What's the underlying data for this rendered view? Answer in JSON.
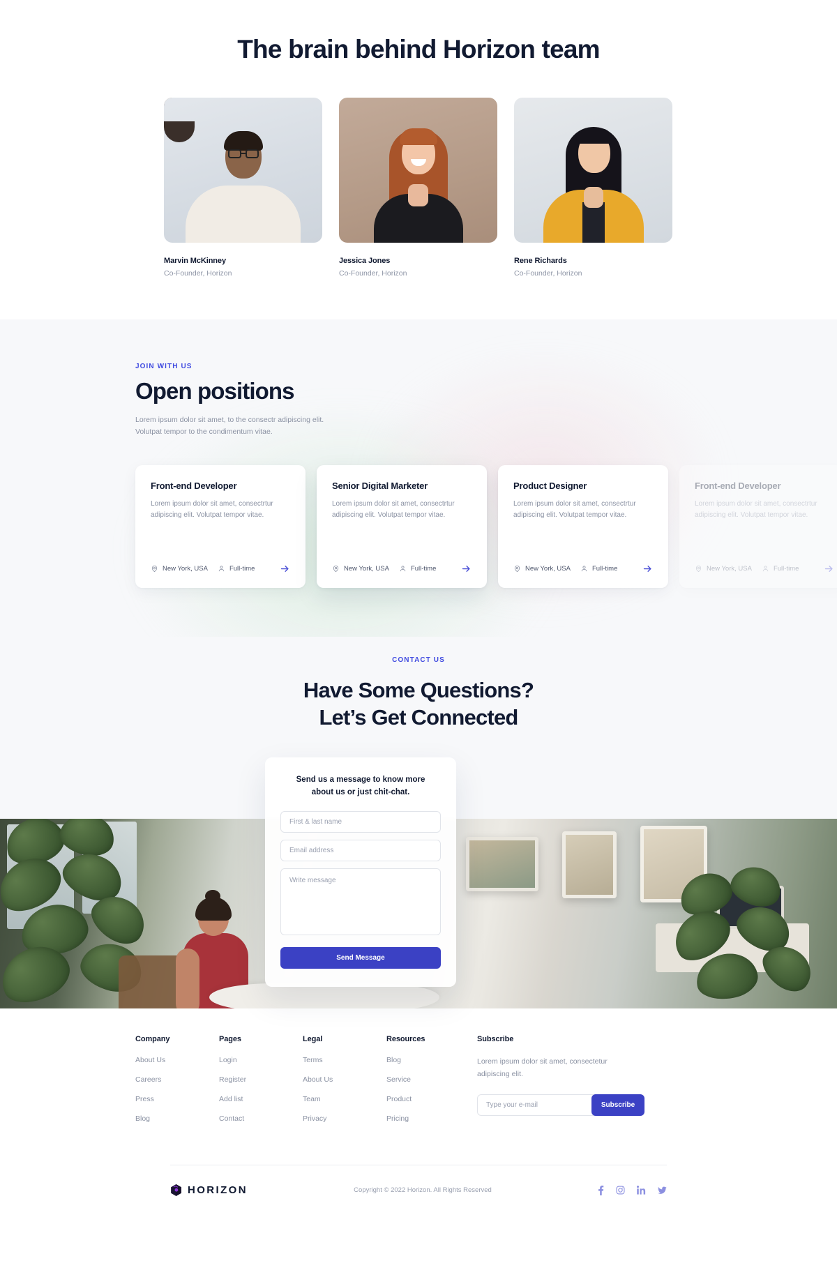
{
  "team": {
    "title": "The brain behind Horizon team",
    "members": [
      {
        "name": "Marvin McKinney",
        "role": "Co-Founder, Horizon",
        "photo": "portrait-man-glasses"
      },
      {
        "name": "Jessica Jones",
        "role": "Co-Founder, Horizon",
        "photo": "portrait-woman-red-hair"
      },
      {
        "name": "Rene Richards",
        "role": "Co-Founder, Horizon",
        "photo": "portrait-woman-yellow-blazer"
      }
    ]
  },
  "jobs": {
    "eyebrow": "JOIN WITH US",
    "heading": "Open positions",
    "subtitle": "Lorem ipsum dolor sit amet, to the consectr adipiscing elit. Volutpat tempor to the condimentum vitae.",
    "cards": [
      {
        "title": "Front-end Developer",
        "description": "Lorem ipsum dolor sit amet, consectrtur adipiscing elit. Volutpat tempor vitae.",
        "location": "New York, USA",
        "type": "Full-time"
      },
      {
        "title": "Senior Digital Marketer",
        "description": "Lorem ipsum dolor sit amet, consectrtur adipiscing elit. Volutpat tempor vitae.",
        "location": "New York, USA",
        "type": "Full-time"
      },
      {
        "title": "Product Designer",
        "description": "Lorem ipsum dolor sit amet, consectrtur adipiscing elit. Volutpat tempor vitae.",
        "location": "New York, USA",
        "type": "Full-time"
      },
      {
        "title": "Front-end Developer",
        "description": "Lorem ipsum dolor sit amet, consectrtur adipiscing elit. Volutpat tempor vitae.",
        "location": "New York, USA",
        "type": "Full-time"
      }
    ]
  },
  "contact": {
    "eyebrow": "CONTACT US",
    "heading_line1": "Have Some Questions?",
    "heading_line2": "Let’s Get Connected",
    "form": {
      "title": "Send us a message to know more\nabout us or just chit-chat.",
      "name_placeholder": "First & last name",
      "name_value": "",
      "email_placeholder": "Email address",
      "email_value": "",
      "message_placeholder": "Write message",
      "message_value": "",
      "submit_label": "Send Message"
    }
  },
  "footer": {
    "columns": [
      {
        "title": "Company",
        "links": [
          "About Us",
          "Careers",
          "Press",
          "Blog"
        ]
      },
      {
        "title": "Pages",
        "links": [
          "Login",
          "Register",
          "Add list",
          "Contact"
        ]
      },
      {
        "title": "Legal",
        "links": [
          "Terms",
          "About Us",
          "Team",
          "Privacy"
        ]
      },
      {
        "title": "Resources",
        "links": [
          "Blog",
          "Service",
          "Product",
          "Pricing"
        ]
      }
    ],
    "subscribe": {
      "title": "Subscribe",
      "text": "Lorem ipsum dolor sit amet, consectetur adipiscing elit.",
      "input_placeholder": "Type your e-mail",
      "input_value": "",
      "button_label": "Subscribe"
    },
    "brand": "HORIZON",
    "copyright": "Copyright © 2022 Horizon. All Rights Reserved",
    "socials": [
      "facebook-icon",
      "instagram-icon",
      "linkedin-icon",
      "twitter-icon"
    ]
  },
  "colors": {
    "accent": "#3b41c4",
    "eyebrow": "#3f4ae0",
    "heading": "#111a31",
    "muted": "#8b92a3",
    "social": "#8b8fe0",
    "section_bg": "#f7f8fa"
  }
}
